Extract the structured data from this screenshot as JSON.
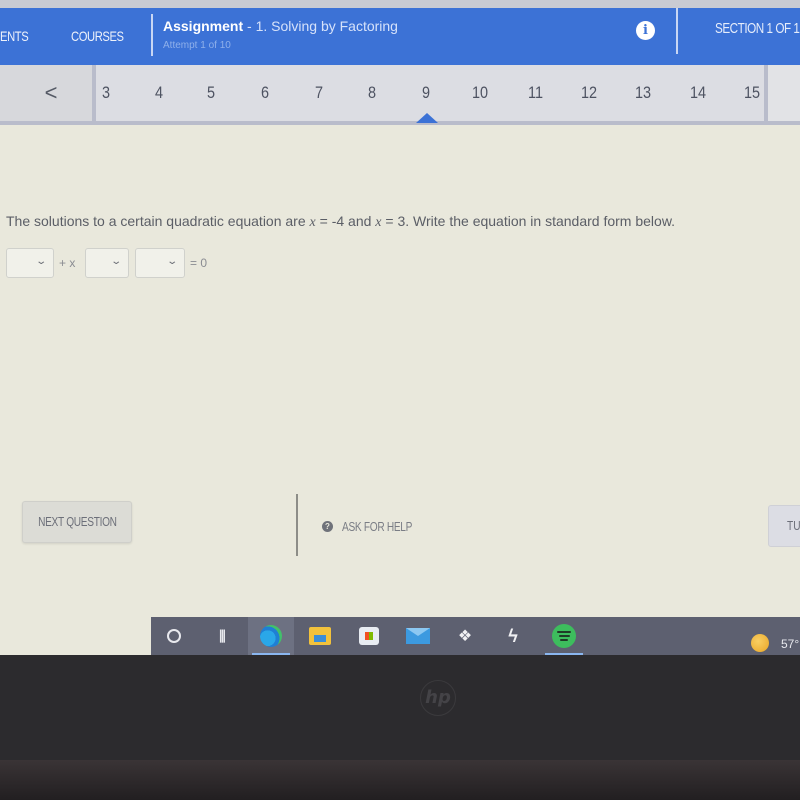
{
  "header": {
    "nav_items": [
      "ENTS",
      "COURSES"
    ],
    "assignment_label": "Assignment",
    "assignment_name": " - 1. Solving by Factoring",
    "attempt": "Attempt 1 of 10",
    "info_icon": "i",
    "section": "SECTION 1 OF 1"
  },
  "question_nav": {
    "prev_icon": "<",
    "numbers": [
      "3",
      "4",
      "5",
      "6",
      "7",
      "8",
      "9",
      "10",
      "11",
      "12",
      "13",
      "14",
      "15"
    ],
    "current": "9"
  },
  "question": {
    "prompt_start": "The solutions to a certain quadratic equation are ",
    "x1_var": "x",
    "x1_val": " = -4",
    "and": " and ",
    "x2_var": "x",
    "x2_val": " = 3",
    "prompt_end": ". Write the equation in standard form below.",
    "dropdowns": [
      {
        "selected": ""
      },
      {
        "selected": ""
      },
      {
        "selected": ""
      }
    ],
    "term_between_1_2": "+ x",
    "equals": "= 0",
    "chevron": "⌄"
  },
  "footer": {
    "next_question": "NEXT QUESTION",
    "ask_for_help": "ASK FOR HELP",
    "help_icon": "?",
    "submit_partial": "TU"
  },
  "taskbar": {
    "items": [
      "search",
      "task-view",
      "edge",
      "file-explorer",
      "store",
      "mail",
      "dropbox",
      "bolt-app",
      "spotify"
    ],
    "weather_temp": "57°"
  },
  "bezel": {
    "brand": "hp"
  }
}
